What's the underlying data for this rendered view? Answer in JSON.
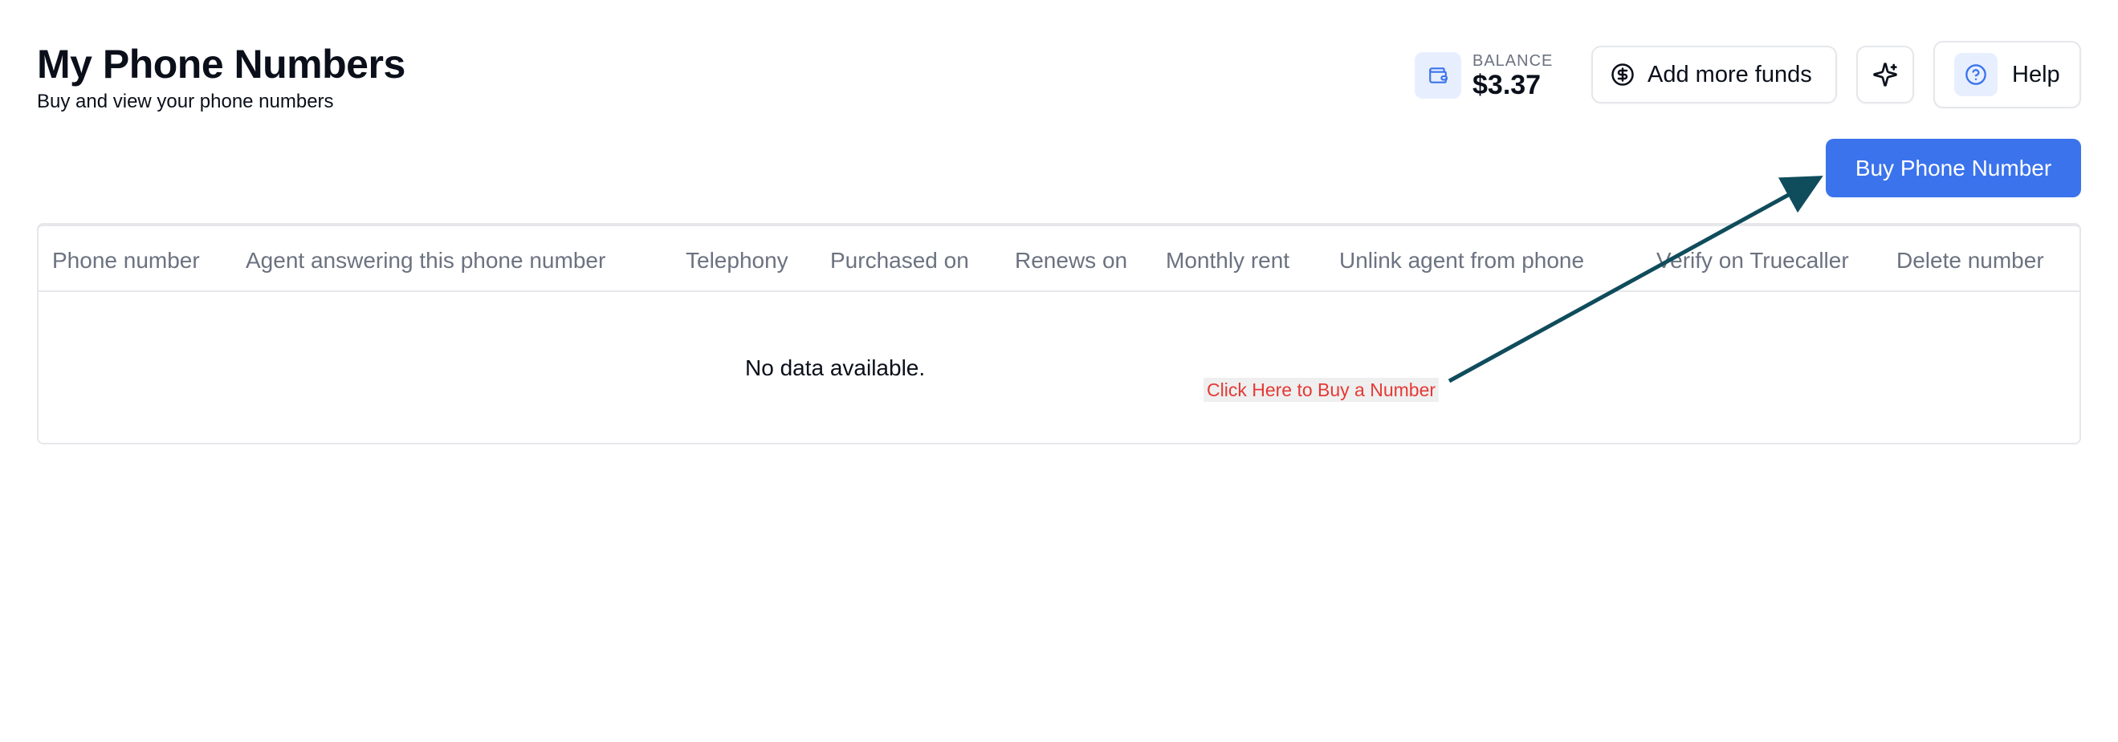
{
  "header": {
    "title": "My Phone Numbers",
    "subtitle": "Buy and view your phone numbers"
  },
  "balance": {
    "label": "BALANCE",
    "value": "$3.37",
    "icon": "wallet-icon"
  },
  "actions": {
    "add_funds_label": "Add more funds",
    "add_funds_icon": "dollar-circle-icon",
    "sparkle_icon": "sparkles-icon",
    "help_label": "Help",
    "help_icon": "question-circle-icon",
    "buy_label": "Buy Phone Number"
  },
  "table": {
    "columns": [
      "Phone number",
      "Agent answering this phone number",
      "Telephony",
      "Purchased on",
      "Renews on",
      "Monthly rent",
      "Unlink agent from phone",
      "Verify on Truecaller",
      "Delete number"
    ],
    "empty_text": "No data available."
  },
  "annotation": {
    "text": "Click Here to Buy a Number",
    "text_color": "#e53935",
    "arrow_color": "#0f4c5c"
  },
  "colors": {
    "primary": "#3b73ec",
    "muted_text": "#6b7280",
    "icon_bg": "#e7efff"
  }
}
